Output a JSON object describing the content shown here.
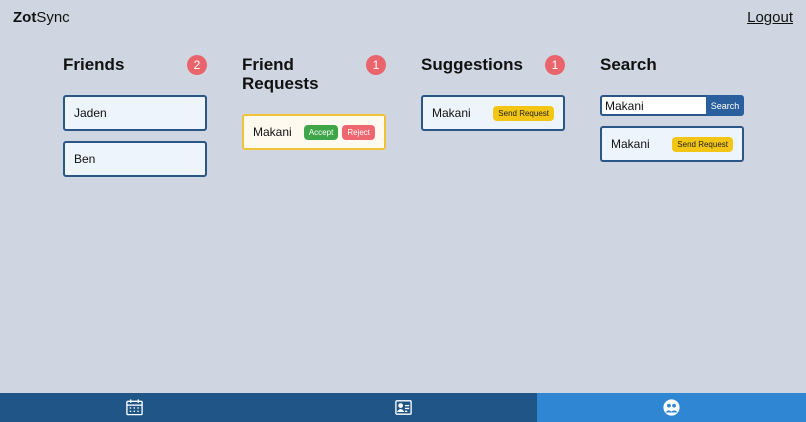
{
  "header": {
    "brand_bold": "Zot",
    "brand_rest": "Sync",
    "logout": "Logout"
  },
  "friends": {
    "title": "Friends",
    "count": "2",
    "items": [
      "Jaden",
      "Ben"
    ]
  },
  "requests": {
    "title": "Friend Requests",
    "count": "1",
    "name": "Makani",
    "accept": "Accept",
    "reject": "Reject"
  },
  "suggestions": {
    "title": "Suggestions",
    "count": "1",
    "name": "Makani",
    "send": "Send Request"
  },
  "search": {
    "title": "Search",
    "value": "Makani",
    "button": "Search",
    "result_name": "Makani",
    "send": "Send Request"
  },
  "nav": {
    "items": [
      "calendar-icon",
      "profile-card-icon",
      "friends-icon"
    ],
    "active": "friends-icon"
  },
  "colors": {
    "background": "#cfd6e1",
    "nav": "#1f5587",
    "nav_active": "#2f87d3",
    "badge": "#e9656b",
    "accent": "#2a5788"
  }
}
